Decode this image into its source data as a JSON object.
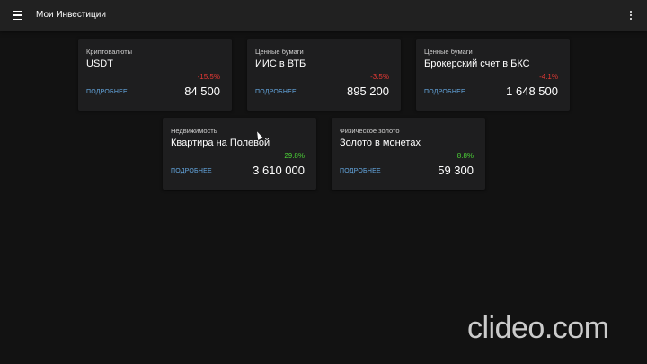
{
  "app": {
    "title": "Мои Инвестиции"
  },
  "cards": [
    {
      "category": "Криптовалюты",
      "name": "USDT",
      "change": "-15.5%",
      "change_color": "#e53935",
      "more_label": "ПОДРОБНЕЕ",
      "value": "84 500"
    },
    {
      "category": "Ценные бумаги",
      "name": "ИИС в ВТБ",
      "change": "-3.5%",
      "change_color": "#e53935",
      "more_label": "ПОДРОБНЕЕ",
      "value": "895 200"
    },
    {
      "category": "Ценные бумаги",
      "name": "Брокерский счет в БКС",
      "change": "-4.1%",
      "change_color": "#e53935",
      "more_label": "ПОДРОБНЕЕ",
      "value": "1 648 500"
    },
    {
      "category": "Недвижимость",
      "name": "Квартира на Полевой",
      "change": "29.8%",
      "change_color": "#4cd137",
      "more_label": "ПОДРОБНЕЕ",
      "value": "3 610 000"
    },
    {
      "category": "Физическое золото",
      "name": "Золото в монетах",
      "change": "8.8%",
      "change_color": "#4cd137",
      "more_label": "ПОДРОБНЕЕ",
      "value": "59 300"
    }
  ],
  "watermark": "clideo.com",
  "icons": {
    "menu": "hamburger-menu-icon",
    "more": "more-vert-icon",
    "cursor": "mouse-cursor-icon"
  }
}
